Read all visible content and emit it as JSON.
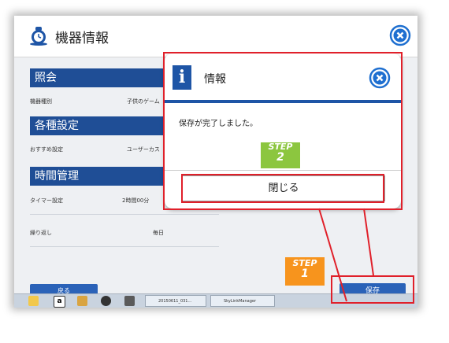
{
  "window": {
    "title": "機器情報",
    "close_icon": "close-circle-icon",
    "app_icon": "robot-clock-icon"
  },
  "sections": {
    "inquiry": {
      "heading": "照会",
      "row_label": "機器種別",
      "row_value": "子供のゲーム"
    },
    "settings": {
      "heading": "各種設定",
      "row_label": "おすすめ設定",
      "row_value": "ユーザーカス"
    },
    "time": {
      "heading": "時間管理",
      "timer_label": "タイマー設定",
      "timer_value": "2時間00分",
      "repeat_label": "繰り返し",
      "repeat_value": "毎日"
    }
  },
  "buttons": {
    "back": "戻る",
    "save": "保存"
  },
  "taskbar": {
    "items": [
      "20150611_031...",
      "SkyLinkManager"
    ]
  },
  "dialog": {
    "title": "情報",
    "message": "保存が完了しました。",
    "close_button": "閉じる"
  },
  "steps": {
    "step1": {
      "label": "STEP",
      "number": "1"
    },
    "step2": {
      "label": "STEP",
      "number": "2"
    }
  },
  "colors": {
    "accent_blue": "#1f4e96",
    "annotation_red": "#e0202a",
    "step1_orange": "#f7941d",
    "step2_green": "#8cc63f"
  }
}
